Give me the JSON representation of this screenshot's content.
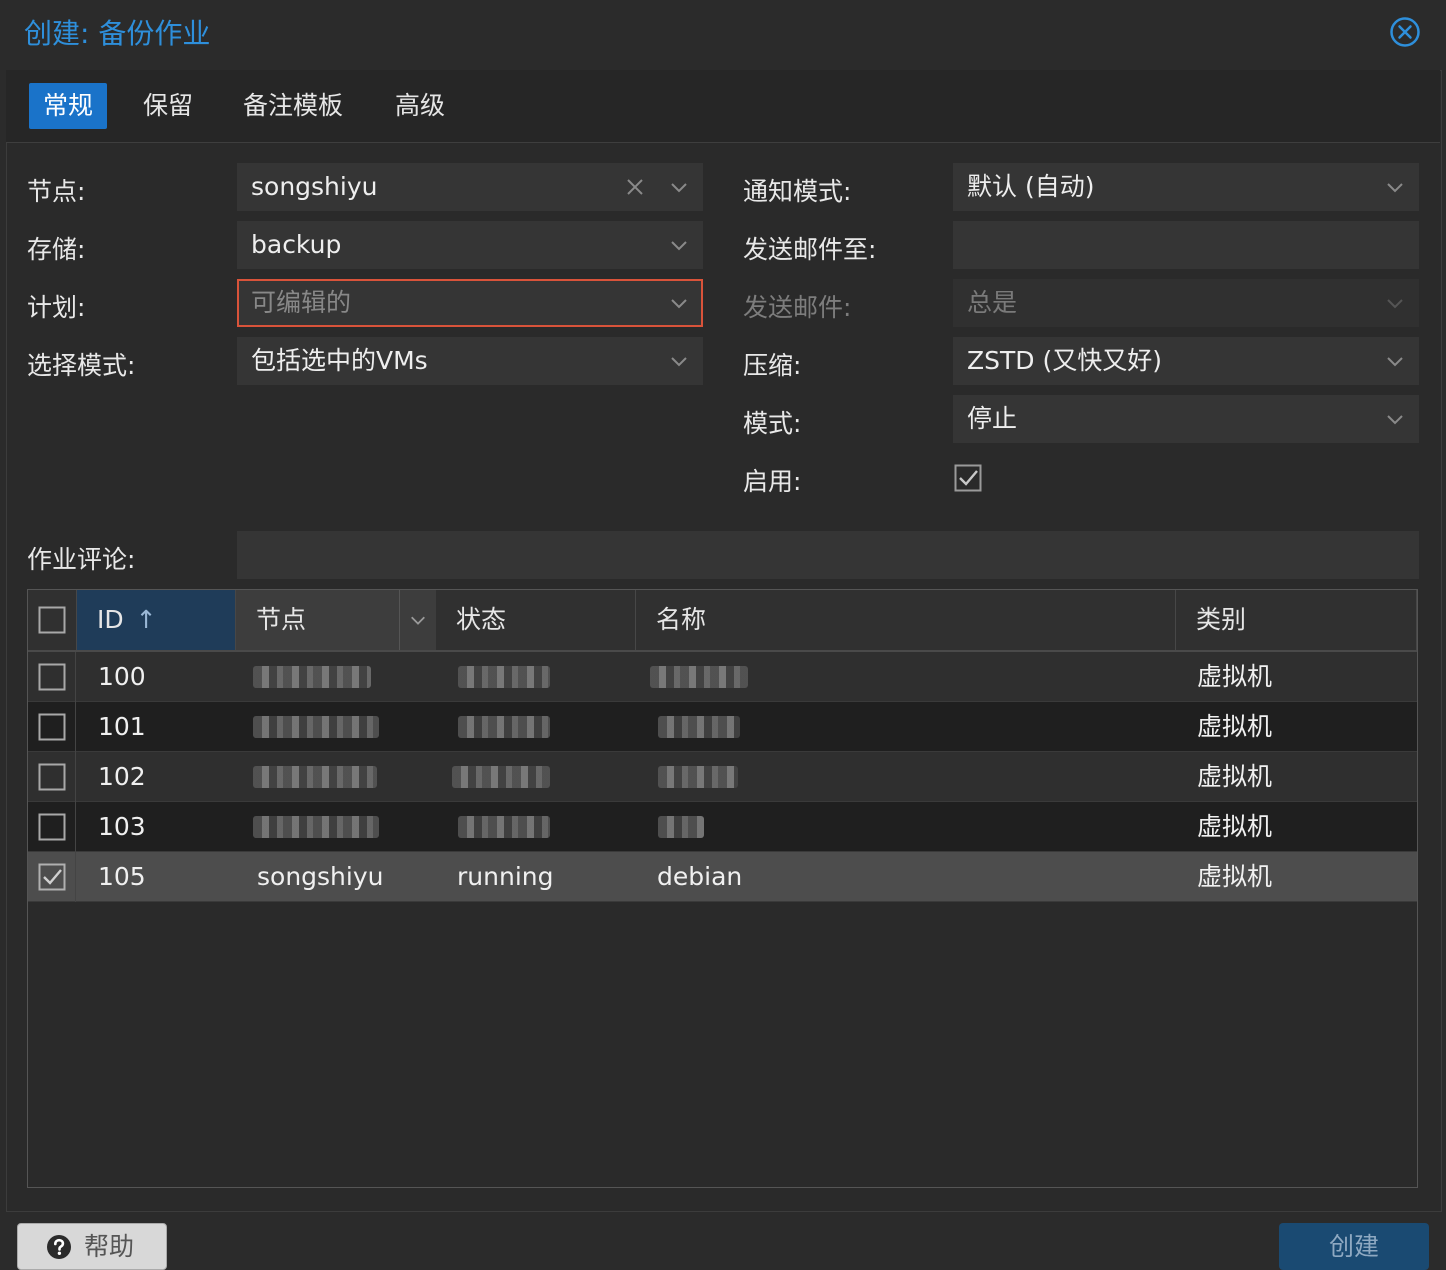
{
  "dialog": {
    "title": "创建: 备份作业"
  },
  "tabs": [
    {
      "label": "常规"
    },
    {
      "label": "保留"
    },
    {
      "label": "备注模板"
    },
    {
      "label": "高级"
    }
  ],
  "form": {
    "node": {
      "label": "节点:",
      "value": "songshiyu"
    },
    "storage": {
      "label": "存储:",
      "value": "backup"
    },
    "schedule": {
      "label": "计划:",
      "placeholder": "可编辑的"
    },
    "selection_mode": {
      "label": "选择模式:",
      "value": "包括选中的VMs"
    },
    "notification_mode": {
      "label": "通知模式:",
      "value": "默认 (自动)"
    },
    "send_email_to": {
      "label": "发送邮件至:",
      "value": ""
    },
    "send_email": {
      "label": "发送邮件:",
      "value": "总是"
    },
    "compression": {
      "label": "压缩:",
      "value": "ZSTD (又快又好)"
    },
    "mode": {
      "label": "模式:",
      "value": "停止"
    },
    "enabled": {
      "label": "启用:",
      "checked": true
    },
    "job_comment": {
      "label": "作业评论:",
      "value": ""
    }
  },
  "grid": {
    "columns": {
      "id": "ID",
      "node": "节点",
      "status": "状态",
      "name": "名称",
      "type": "类别"
    },
    "sort_indicator": "↑",
    "rows": [
      {
        "id": "100",
        "node": "",
        "status": "",
        "name": "",
        "type": "虚拟机",
        "checked": false,
        "redacted": true
      },
      {
        "id": "101",
        "node": "",
        "status": "",
        "name": "",
        "type": "虚拟机",
        "checked": false,
        "redacted": true
      },
      {
        "id": "102",
        "node": "",
        "status": "",
        "name": "",
        "type": "虚拟机",
        "checked": false,
        "redacted": true
      },
      {
        "id": "103",
        "node": "",
        "status": "",
        "name": "",
        "type": "虚拟机",
        "checked": false,
        "redacted": true
      },
      {
        "id": "105",
        "node": "songshiyu",
        "status": "running",
        "name": "debian",
        "type": "虚拟机",
        "checked": true,
        "redacted": false
      }
    ]
  },
  "buttons": {
    "help": "帮助",
    "create": "创建"
  },
  "colors": {
    "accent": "#1a73c9",
    "title": "#2e8fdb",
    "invalid": "#d9533a"
  }
}
